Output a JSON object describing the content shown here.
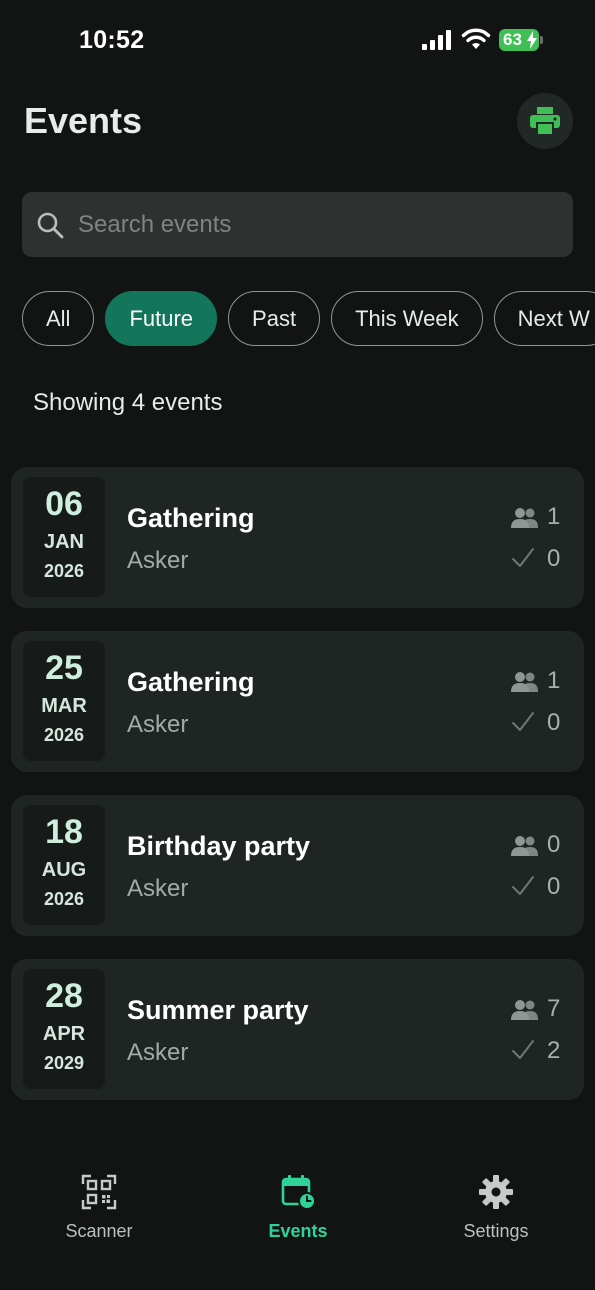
{
  "status_bar": {
    "time": "10:52",
    "battery": "63"
  },
  "header": {
    "title": "Events",
    "print_icon": "printer-icon"
  },
  "search": {
    "placeholder": "Search events",
    "value": ""
  },
  "filters": [
    {
      "label": "All",
      "active": false
    },
    {
      "label": "Future",
      "active": true
    },
    {
      "label": "Past",
      "active": false
    },
    {
      "label": "This Week",
      "active": false
    },
    {
      "label": "Next W",
      "active": false
    }
  ],
  "summary": "Showing 4 events",
  "events": [
    {
      "day": "06",
      "month": "JAN",
      "year": "2026",
      "title": "Gathering",
      "subtitle": "Asker",
      "attendees": "1",
      "checked_in": "0"
    },
    {
      "day": "25",
      "month": "MAR",
      "year": "2026",
      "title": "Gathering",
      "subtitle": "Asker",
      "attendees": "1",
      "checked_in": "0"
    },
    {
      "day": "18",
      "month": "AUG",
      "year": "2026",
      "title": "Birthday party",
      "subtitle": "Asker",
      "attendees": "0",
      "checked_in": "0"
    },
    {
      "day": "28",
      "month": "APR",
      "year": "2029",
      "title": "Summer party",
      "subtitle": "Asker",
      "attendees": "7",
      "checked_in": "2"
    }
  ],
  "bottom_nav": [
    {
      "label": "Scanner",
      "icon": "qr-code-icon",
      "active": false
    },
    {
      "label": "Events",
      "icon": "calendar-icon",
      "active": true
    },
    {
      "label": "Settings",
      "icon": "gear-icon",
      "active": false
    }
  ],
  "colors": {
    "background": "#111413",
    "card": "#1f2523",
    "accent": "#137559",
    "nav_active": "#2fd39a",
    "print_icon": "#3fbf55",
    "battery": "#3fbf55"
  }
}
